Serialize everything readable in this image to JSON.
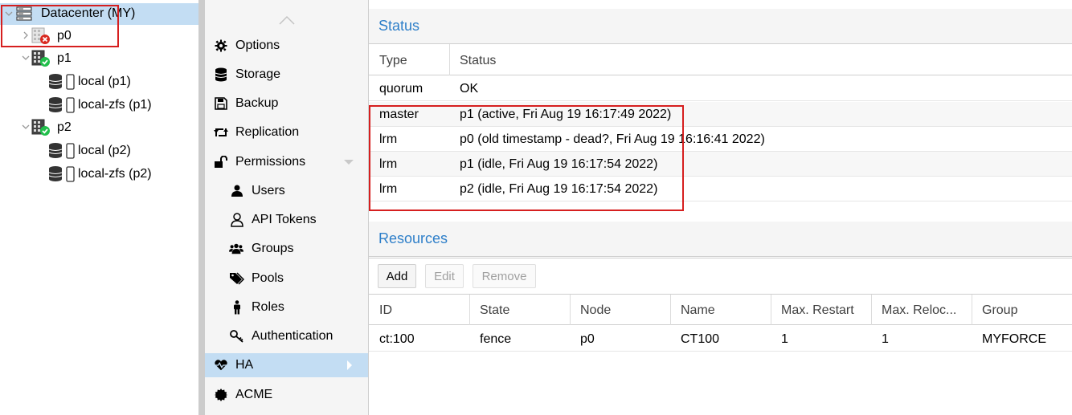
{
  "tree": {
    "datacenter": {
      "label": "Datacenter (MY)",
      "icon": "server-rack-icon"
    },
    "nodes": [
      {
        "label": "p0",
        "status": "offline",
        "expanded": false,
        "storages": []
      },
      {
        "label": "p1",
        "status": "online",
        "expanded": true,
        "storages": [
          {
            "label": "local (p1)"
          },
          {
            "label": "local-zfs (p1)"
          }
        ]
      },
      {
        "label": "p2",
        "status": "online",
        "expanded": true,
        "storages": [
          {
            "label": "local (p2)"
          },
          {
            "label": "local-zfs (p2)"
          }
        ]
      }
    ]
  },
  "menu": {
    "items": [
      {
        "label": "Options",
        "icon": "gear-icon"
      },
      {
        "label": "Storage",
        "icon": "database-icon"
      },
      {
        "label": "Backup",
        "icon": "floppy-disk-icon"
      },
      {
        "label": "Replication",
        "icon": "retweet-icon"
      },
      {
        "label": "Permissions",
        "icon": "unlock-icon"
      },
      {
        "label": "Users",
        "icon": "user-icon"
      },
      {
        "label": "API Tokens",
        "icon": "user-outline-icon"
      },
      {
        "label": "Groups",
        "icon": "users-icon"
      },
      {
        "label": "Pools",
        "icon": "tags-icon"
      },
      {
        "label": "Roles",
        "icon": "male-icon"
      },
      {
        "label": "Authentication",
        "icon": "key-icon"
      },
      {
        "label": "HA",
        "icon": "heartbeat-icon"
      },
      {
        "label": "ACME",
        "icon": "certificate-icon"
      }
    ],
    "active": "HA"
  },
  "status": {
    "title": "Status",
    "columns": [
      "Type",
      "Status"
    ],
    "rows": [
      {
        "type": "quorum",
        "status": "OK"
      },
      {
        "type": "master",
        "status": "p1 (active, Fri Aug 19 16:17:49 2022)"
      },
      {
        "type": "lrm",
        "status": "p0 (old timestamp - dead?, Fri Aug 19 16:16:41 2022)"
      },
      {
        "type": "lrm",
        "status": "p1 (idle, Fri Aug 19 16:17:54 2022)"
      },
      {
        "type": "lrm",
        "status": "p2 (idle, Fri Aug 19 16:17:54 2022)"
      }
    ]
  },
  "resources": {
    "title": "Resources",
    "toolbar": {
      "add": "Add",
      "edit": "Edit",
      "remove": "Remove"
    },
    "columns": [
      "ID",
      "State",
      "Node",
      "Name",
      "Max. Restart",
      "Max. Reloc...",
      "Group"
    ],
    "rows": [
      {
        "id": "ct:100",
        "state": "fence",
        "node": "p0",
        "name": "CT100",
        "max_restart": "1",
        "max_relocate": "1",
        "group": "MYFORCE"
      }
    ]
  },
  "colors": {
    "accent": "#2e7fc9",
    "selection": "#c3ddf3",
    "annotation": "#d61f1f",
    "online": "#21bf4b",
    "offline": "#d9291f"
  }
}
